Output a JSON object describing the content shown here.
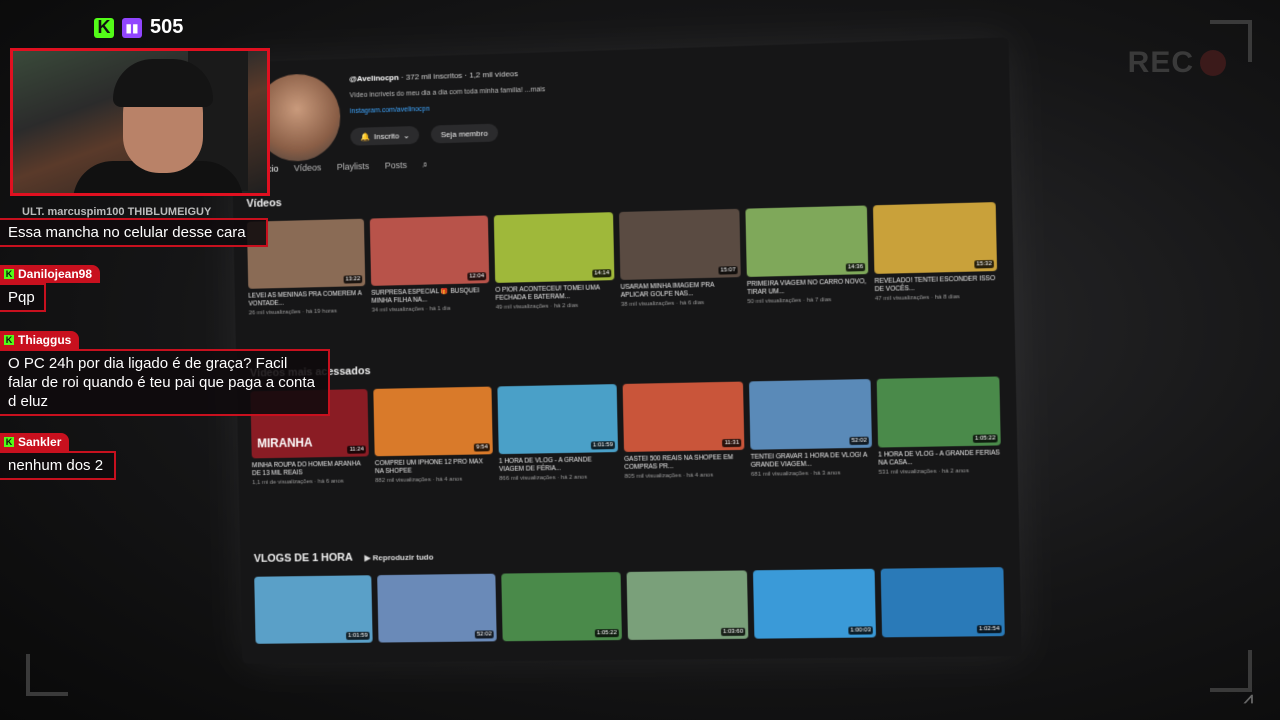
{
  "stream": {
    "viewer_count": "505",
    "rec_label": "REC"
  },
  "chat": [
    {
      "user": "ULT.",
      "user2": "marcuspim100",
      "user3": "THIBLUMEIGUY",
      "text": "Essa mancha no celular desse cara"
    },
    {
      "user": "Danilojean98",
      "text": "Pqp"
    },
    {
      "user": "Thiaggus",
      "text": "O PC 24h por dia ligado é de graça? Facil falar de roi quando é teu pai que paga a conta d eluz"
    },
    {
      "user": "Sankler",
      "text": "nenhum dos 2"
    }
  ],
  "channel": {
    "handle": "@Avelinocpn",
    "stats": " · 372 mil inscritos · 1,2 mil vídeos",
    "description": "Vídeo incríveis do meu dia a dia com toda minha família! ...mais",
    "link": "instagram.com/avelinocpn",
    "subscribed_label": "Inscrito",
    "member_label": "Seja membro",
    "tabs": [
      "Início",
      "Vídeos",
      "Playlists",
      "Posts"
    ]
  },
  "sections": [
    {
      "title": "Vídeos",
      "videos": [
        {
          "title": "LEVEI AS MENINAS PRA COMEREM A VONTADE...",
          "meta": "26 mil visualizações · há 19 horas",
          "duration": "13:22",
          "color": "#8a6b55"
        },
        {
          "title": "SURPRESA ESPECIAL 🎁 BUSQUEI MINHA FILHA NA...",
          "meta": "34 mil visualizações · há 1 dia",
          "duration": "12:04",
          "color": "#b8534a"
        },
        {
          "title": "O PIOR ACONTECEU! TOMEI UMA FECHADA E BATERAM...",
          "meta": "49 mil visualizações · há 2 dias",
          "duration": "14:14",
          "color": "#9fb83a"
        },
        {
          "title": "USARAM MINHA IMAGEM PRA APLICAR GOLPE NAS...",
          "meta": "38 mil visualizações · há 6 dias",
          "duration": "15:07",
          "color": "#5a4b42"
        },
        {
          "title": "PRIMEIRA VIAGEM NO CARRO NOVO, TIRAR UM...",
          "meta": "50 mil visualizações · há 7 dias",
          "duration": "14:36",
          "color": "#7fa85a"
        },
        {
          "title": "REVELADO! TENTEI ESCONDER ISSO DE VOCÊS...",
          "meta": "47 mil visualizações · há 8 dias",
          "duration": "15:32",
          "color": "#c9a13a"
        }
      ]
    },
    {
      "title": "Vídeos mais acessados",
      "videos": [
        {
          "title": "MINHA ROUPA DO HOMEM ARANHA DE 13 MIL REAIS",
          "meta": "1,1 mi de visualizações · há 6 anos",
          "duration": "11:24",
          "color": "#8a1c24",
          "label": "MIRANHA"
        },
        {
          "title": "COMPREI UM IPHONE 12 PRO MAX NA SHOPEE",
          "meta": "882 mil visualizações · há 4 anos",
          "duration": "9:54",
          "color": "#d97a2a"
        },
        {
          "title": "1 HORA DE VLOG - A GRANDE VIAGEM DE FÉRIA...",
          "meta": "866 mil visualizações · há 2 anos",
          "duration": "1:01:59",
          "color": "#4aa0c8"
        },
        {
          "title": "GASTEI 500 REAIS NA SHOPEE EM COMPRAS PR...",
          "meta": "805 mil visualizações · há 4 anos",
          "duration": "11:31",
          "color": "#c9553a"
        },
        {
          "title": "TENTEI GRAVAR 1 HORA DE VLOG! A GRANDE VIAGEM...",
          "meta": "681 mil visualizações · há 3 anos",
          "duration": "52:02",
          "color": "#5a8ab8"
        },
        {
          "title": "1 HORA DE VLOG - A GRANDE FÉRIAS NA CASA...",
          "meta": "531 mil visualizações · há 2 anos",
          "duration": "1:05:22",
          "color": "#4a8a4a"
        }
      ]
    },
    {
      "title": "VLOGS DE 1 HORA",
      "play_all": "Reproduzir tudo",
      "videos": [
        {
          "duration": "1:01:59",
          "color": "#5aa0c8"
        },
        {
          "duration": "52:02",
          "color": "#6a8ab8"
        },
        {
          "duration": "1:05:22",
          "color": "#4a8a4a"
        },
        {
          "duration": "1:03:60",
          "color": "#7aa07a"
        },
        {
          "duration": "1:00:03",
          "color": "#3a9ad8"
        },
        {
          "duration": "1:02:54",
          "color": "#2a7ab8"
        }
      ]
    }
  ],
  "colors": {
    "accent_red": "#c8101e",
    "kick_green": "#53fc18",
    "twitch_purple": "#9146ff"
  }
}
